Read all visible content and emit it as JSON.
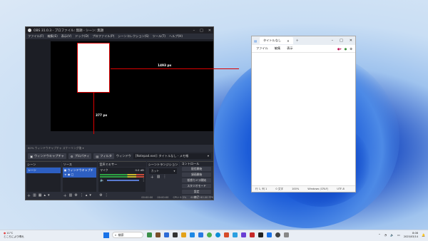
{
  "obs": {
    "title": "OBS 31.0.3 - プロファイル: 無題 - シーン: 無題",
    "menu": [
      "ファイル(F)",
      "編集(E)",
      "表示(V)",
      "ドック(D)",
      "プロファイル(P)",
      "シーンコレクション(S)",
      "ツール(T)",
      "ヘルプ(H)"
    ],
    "measure_width": "1493 px",
    "measure_height": "377 px",
    "status_line": "60%  ウィンドウキャプチャ スケーリング後  ▾",
    "toolbar": {
      "source_label": "ウィンドウキャプチャ",
      "properties": "プロパティ",
      "filters": "フィルタ",
      "window_label": "ウィンドウ",
      "window_value": "[Notepad.exe]: タイトルなし - メモ帳"
    },
    "docks": {
      "scenes": {
        "title": "シーン",
        "items": [
          "シーン"
        ]
      },
      "sources": {
        "title": "ソース",
        "items": [
          "ウィンドウキャプチャ"
        ]
      },
      "mixer": {
        "title": "音声ミキサー",
        "channel": "マイク",
        "level": "0.0 dB"
      },
      "transitions": {
        "title": "シーントランジション",
        "type": "カット",
        "duration_label": "期間",
        "duration": "300 ms"
      },
      "controls": {
        "title": "コントロール",
        "buttons": [
          "配信開始",
          "録画開始",
          "仮想カメラ開始",
          "スタジオモード",
          "設定",
          "終了"
        ]
      }
    },
    "status_bar": {
      "time1": "00:00:00",
      "time2": "00:00:00",
      "cpu": "CPU: 0.3%",
      "fps": "60.00 / 60.00 FPS"
    }
  },
  "notepad": {
    "tab_title": "タイトルなし",
    "menu": [
      "ファイル",
      "編集",
      "表示"
    ],
    "status": {
      "position": "行 1, 列 1",
      "chars": "0 文字",
      "zoom": "100%",
      "line_ending": "Windows (CRLF)",
      "encoding": "UTF-8"
    }
  },
  "taskbar": {
    "weather_temp": "11°C",
    "weather_desc": "ところにより晴れ",
    "search_placeholder": "検索",
    "time": "8:08",
    "date": "2025/03/14"
  },
  "colors": {
    "obs_bg": "#2b2e38",
    "selection": "#2d5fc2",
    "accent": "#d00000"
  }
}
